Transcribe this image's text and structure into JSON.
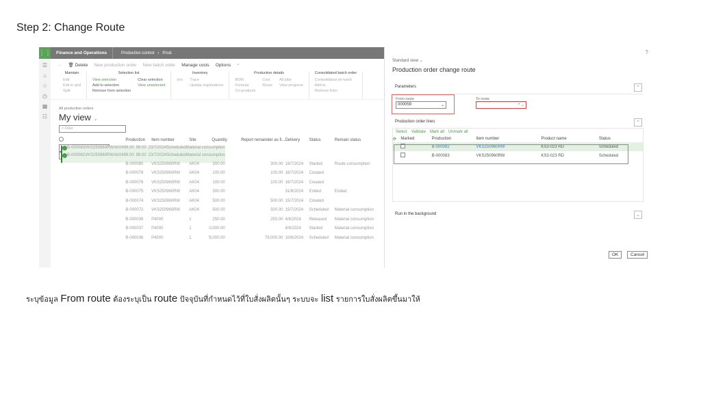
{
  "step_title": "Step 2: Change Route",
  "caption": {
    "p1": "ระบุข้อมูล ",
    "k1": "From route",
    "p2": "  ต้องระบุเป็น ",
    "k2": "route",
    "p3": " ปัจจุบันที่กำหนดไว้ที่ใบสั่งผลิตนั้นๆ ระบบจะ ",
    "k3": "list",
    "p4": " รายการใบสั่งผลิตขึ้นมาให้"
  },
  "fo": {
    "app_name": "Finance and Operations",
    "breadcrumb": [
      "Production control",
      "Prod."
    ],
    "actions": [
      "Delete",
      "New production order",
      "New batch order",
      "Manage costs",
      "Options"
    ],
    "ribbon": [
      {
        "title": "Maintain",
        "cols": [
          [
            "Edit",
            "Edit in grid",
            "Split"
          ]
        ]
      },
      {
        "title": "Selection list",
        "cols": [
          [
            "View selection",
            "Add to selection",
            "Remove from selection"
          ],
          [
            "Clear selection",
            "View unselected"
          ]
        ]
      },
      {
        "title": "Inventory",
        "cols": [
          [
            "ons"
          ],
          [
            "Trace",
            "Update registrations"
          ]
        ]
      },
      {
        "title": "Production details",
        "cols": [
          [
            "BOM",
            "Formula",
            "Co-products"
          ],
          [
            "Cost",
            "Route"
          ],
          [
            "All jobs",
            "View progress"
          ]
        ]
      },
      {
        "title": "Consolidated batch order",
        "cols": [
          [
            "Consolidated on-hand",
            "Add to",
            "Remove from"
          ]
        ]
      }
    ],
    "list_breadcrumb": "All production orders",
    "view_name": "My view",
    "filter_placeholder": "Filter",
    "columns": [
      "Production",
      "Item number",
      "Site",
      "Quantity",
      "Report remainder as fi...",
      "Delivery",
      "Status",
      "Remain status"
    ],
    "rows": [
      {
        "sel": true,
        "prod": "B-000083",
        "item": "VKS250960RW",
        "site": "AK04",
        "qty": "99.00",
        "rem": "99.00",
        "del": "23/7/2024",
        "status": "Scheduled",
        "rstat": "Material consumption"
      },
      {
        "sel": true,
        "prod": "B-000082",
        "item": "VKS250960RW",
        "site": "AK04",
        "qty": "99.00",
        "rem": "99.00",
        "del": "23/7/2024",
        "status": "Scheduled",
        "rstat": "Material consumption"
      },
      {
        "sel": false,
        "prod": "B-000080",
        "item": "VKS250960RW",
        "site": "AK04",
        "qty": "300.00",
        "rem": "300.00",
        "del": "19/7/2024",
        "status": "Started",
        "rstat": "Route consumption"
      },
      {
        "sel": false,
        "prod": "B-000078",
        "item": "VKS250960RW",
        "site": "AK04",
        "qty": "100.00",
        "rem": "100.00",
        "del": "16/7/2024",
        "status": "Created",
        "rstat": ""
      },
      {
        "sel": false,
        "prod": "B-000076",
        "item": "VKS250960RW",
        "site": "AK04",
        "qty": "100.00",
        "rem": "100.00",
        "del": "16/7/2024",
        "status": "Created",
        "rstat": ""
      },
      {
        "sel": false,
        "prod": "B-000075",
        "item": "VKS250960RW",
        "site": "AK04",
        "qty": "300.00",
        "rem": "",
        "del": "31/8/2024",
        "status": "Ended",
        "rstat": "Ended"
      },
      {
        "sel": false,
        "prod": "B-000074",
        "item": "VKS250960RW",
        "site": "AK04",
        "qty": "500.00",
        "rem": "500.00",
        "del": "15/7/2024",
        "status": "Created",
        "rstat": ""
      },
      {
        "sel": false,
        "prod": "B-000072",
        "item": "VKS250960RW",
        "site": "AK04",
        "qty": "500.00",
        "rem": "500.00",
        "del": "15/7/2024",
        "status": "Scheduled",
        "rstat": "Material consumption"
      },
      {
        "sel": false,
        "prod": "B-000038",
        "item": "P4000",
        "site": "1",
        "qty": "250.00",
        "rem": "250.00",
        "del": "4/6/2024",
        "status": "Released",
        "rstat": "Material consumption"
      },
      {
        "sel": false,
        "prod": "B-000037",
        "item": "P4000",
        "site": "1",
        "qty": "0,000.00",
        "rem": "",
        "del": "4/6/2024",
        "status": "Started",
        "rstat": "Material consumption"
      },
      {
        "sel": false,
        "prod": "B-000036",
        "item": "P4000",
        "site": "1",
        "qty": "'9,000.00",
        "rem": "79,000.00",
        "del": "10/6/2024",
        "status": "Scheduled",
        "rstat": "Material consumption"
      }
    ]
  },
  "dialog": {
    "help": "?",
    "view": "Standard view",
    "title": "Production order change route",
    "parameters_label": "Parameters",
    "from_route_label": "From route",
    "from_route_value": "000059",
    "to_route_label": "To route",
    "to_route_value": "",
    "lines_label": "Production order lines",
    "line_actions": [
      "Select",
      "Validate",
      "Mark all",
      "Unmark all"
    ],
    "line_columns": [
      "Marked",
      "Production",
      "Item number",
      "Product name",
      "Status"
    ],
    "lines": [
      {
        "prod": "B-000082",
        "item": "VKS250960RW",
        "name": "KS3-023 RD",
        "status": "Scheduled"
      },
      {
        "prod": "B-000083",
        "item": "VKS250960RW",
        "name": "KS3-023 RD",
        "status": "Scheduled"
      }
    ],
    "background_label": "Run in the background",
    "ok": "OK",
    "cancel": "Cancel"
  }
}
